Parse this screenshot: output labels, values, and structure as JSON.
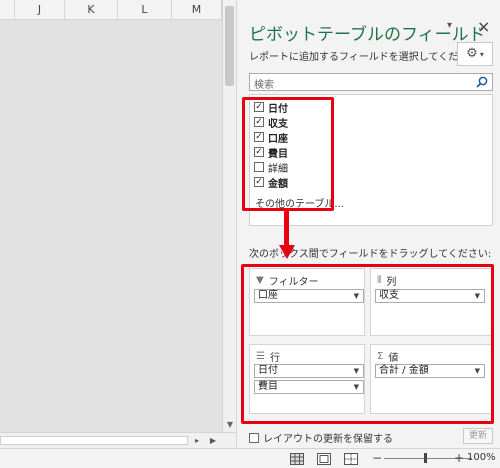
{
  "sheet": {
    "columns": [
      "J",
      "K",
      "L",
      "M"
    ]
  },
  "pane": {
    "title": "ピボットテーブルのフィールド",
    "subtitle": "レポートに追加するフィールドを選択してください:",
    "search_placeholder": "検索",
    "fields": [
      {
        "label": "日付",
        "checked": true
      },
      {
        "label": "収支",
        "checked": true
      },
      {
        "label": "口座",
        "checked": true
      },
      {
        "label": "費目",
        "checked": true
      },
      {
        "label": "詳細",
        "checked": false
      },
      {
        "label": "金額",
        "checked": true
      }
    ],
    "more_tables": "その他のテーブル...",
    "drag_hint": "次のボックス間でフィールドをドラッグしてください:",
    "zones": {
      "filters": {
        "title": "フィルター",
        "items": [
          "口座"
        ]
      },
      "columns": {
        "title": "列",
        "items": [
          "収支"
        ]
      },
      "rows": {
        "title": "行",
        "items": [
          "日付",
          "費目"
        ]
      },
      "values": {
        "title": "値",
        "items": [
          "合計 / 金額"
        ]
      }
    },
    "defer_label": "レイアウトの更新を保留する",
    "update_label": "更新"
  },
  "status": {
    "zoom_label": "100%",
    "zoom_minus": "−",
    "zoom_plus": "+"
  },
  "colors": {
    "title_green": "#217346",
    "annotation_red": "#e60012"
  }
}
